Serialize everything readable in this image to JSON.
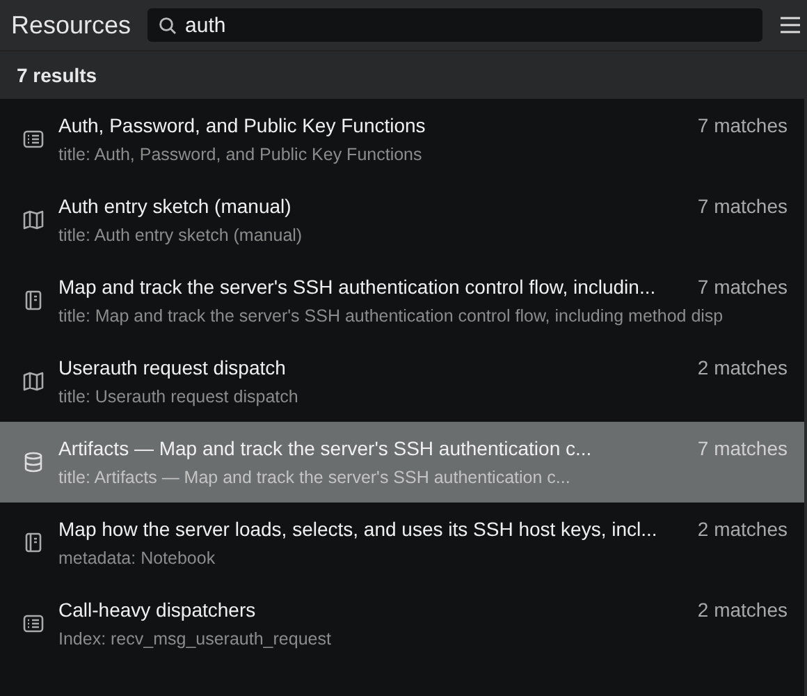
{
  "header": {
    "title": "Resources",
    "search": {
      "value": "auth"
    }
  },
  "results_count": "7 results",
  "results": [
    {
      "kind": "list",
      "title": "Auth, Password, and Public Key Functions",
      "subtitle": "title: Auth, Password, and Public Key Functions",
      "matches": "7 matches",
      "selected": false
    },
    {
      "kind": "map",
      "title": "Auth entry sketch (manual)",
      "subtitle": "title: Auth entry sketch (manual)",
      "matches": "7 matches",
      "selected": false
    },
    {
      "kind": "notebook",
      "title": "Map and track the server's SSH authentication control flow, includin...",
      "subtitle": "title: Map and track the server's SSH authentication control flow, including method disp",
      "matches": "7 matches",
      "selected": false
    },
    {
      "kind": "map",
      "title": "Userauth request dispatch",
      "subtitle": "title: Userauth request dispatch",
      "matches": "2 matches",
      "selected": false
    },
    {
      "kind": "database",
      "title": "Artifacts — Map and track the server's SSH authentication c...",
      "subtitle": "title: Artifacts — Map and track the server's SSH authentication c...",
      "matches": "7 matches",
      "selected": true
    },
    {
      "kind": "notebook",
      "title": "Map how the server loads, selects, and uses its SSH host keys, incl...",
      "subtitle": "metadata: Notebook",
      "matches": "2 matches",
      "selected": false
    },
    {
      "kind": "list",
      "title": "Call-heavy dispatchers",
      "subtitle": "Index: recv_msg_userauth_request",
      "matches": "2 matches",
      "selected": false
    }
  ]
}
